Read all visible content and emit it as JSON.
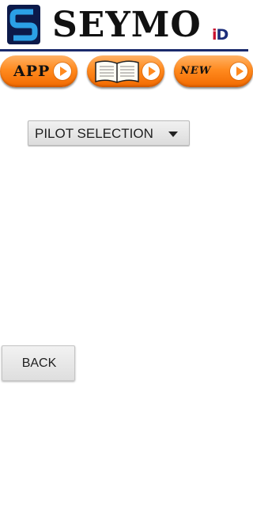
{
  "header": {
    "brand": "SEYMO",
    "logo_icon": "s-logo-icon",
    "badge": {
      "i": "i",
      "d": "D"
    },
    "rule_color": "#1a2a6c"
  },
  "nav": {
    "app_label": "APP",
    "book_icon": "open-book-icon",
    "new_label": "NEW",
    "play_icon": "play-circle-icon",
    "accent": "#ff8a1f"
  },
  "selector": {
    "selected": "PILOT SELECTION",
    "caret_icon": "caret-down-icon"
  },
  "actions": {
    "back_label": "BACK"
  }
}
